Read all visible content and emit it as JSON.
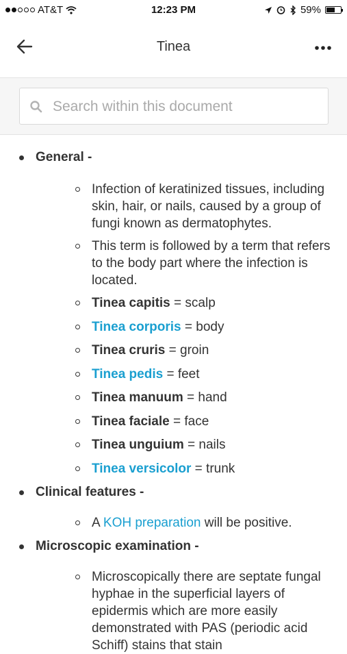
{
  "status_bar": {
    "carrier": "AT&T",
    "time": "12:23 PM",
    "battery": "59%",
    "battery_level": 0.59
  },
  "nav": {
    "title": "Tinea"
  },
  "search": {
    "placeholder": "Search within this document"
  },
  "doc": {
    "general": {
      "heading": "General -",
      "definition1": "Infection of keratinized tissues, including skin, hair, or nails, caused by a group of fungi known as dermatophytes.",
      "definition2": "This term is followed by a term that refers to the body part where the infection is located.",
      "items": [
        {
          "term": "Tinea capitis",
          "desc": " = scalp"
        },
        {
          "term": "Tinea corporis",
          "desc": " = body"
        },
        {
          "term": "Tinea cruris",
          "desc": " = groin"
        },
        {
          "term": "Tinea pedis",
          "desc": " = feet"
        },
        {
          "term": "Tinea manuum",
          "desc": " = hand"
        },
        {
          "term": "Tinea faciale",
          "desc": " = face"
        },
        {
          "term": "Tinea unguium",
          "desc": " = nails"
        },
        {
          "term": "Tinea versicolor",
          "desc": " = trunk"
        }
      ]
    },
    "clinical": {
      "heading": "Clinical features -",
      "prefix": "A ",
      "link": "KOH preparation",
      "suffix": " will be positive."
    },
    "microscopic": {
      "heading": "Microscopic examination -",
      "text": "Microscopically there are septate fungal hyphae in the superficial layers of epidermis which are more easily demonstrated with PAS (periodic acid Schiff) stains that stain"
    }
  },
  "colors": {
    "link": "#1a9fd0",
    "text": "#333333"
  }
}
